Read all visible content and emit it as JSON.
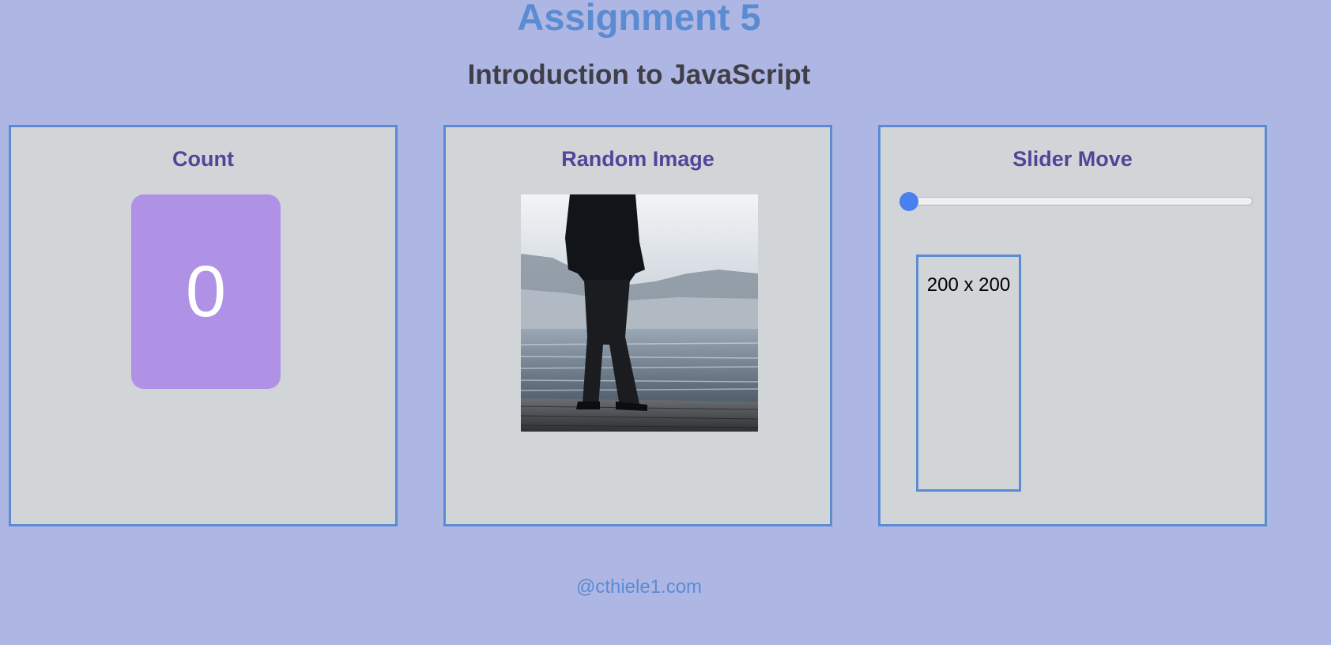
{
  "header": {
    "title": "Assignment 5",
    "subtitle": "Introduction to JavaScript"
  },
  "count_panel": {
    "heading": "Count",
    "value": "0"
  },
  "image_panel": {
    "heading": "Random Image",
    "image_description": "person-standing-on-misty-lake-dock"
  },
  "slider_panel": {
    "heading": "Slider Move",
    "slider_level": 0,
    "box_label": "200 x 200"
  },
  "footer": {
    "text": "@cthiele1.com"
  },
  "colors": {
    "background": "#aeb6e3",
    "panel": "#d1d5d7",
    "accent_border": "#5a8bd3",
    "heading": "#53449b",
    "count_box": "#af92e6",
    "slider_thumb": "#4a7ff0"
  }
}
